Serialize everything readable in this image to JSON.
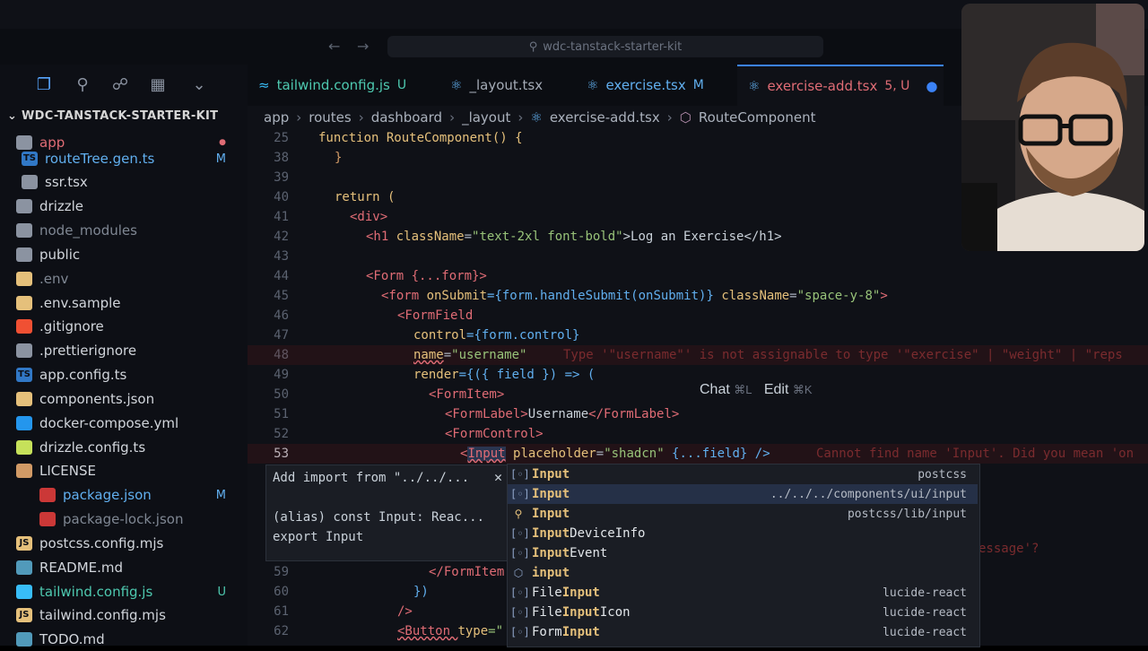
{
  "search": {
    "text": "wdc-tanstack-starter-kit"
  },
  "explorer": {
    "title": "WDC-TANSTACK-STARTER-KIT",
    "items": [
      {
        "label": "app",
        "badge": "",
        "color": "#e06c75"
      },
      {
        "label": "routeTree.gen.ts",
        "badge": "M",
        "color": "#61afef"
      },
      {
        "label": "ssr.tsx",
        "badge": "",
        "color": "#d1d5db"
      },
      {
        "label": "drizzle",
        "badge": "",
        "color": "#d1d5db"
      },
      {
        "label": "node_modules",
        "badge": "",
        "color": "#7f8793"
      },
      {
        "label": "public",
        "badge": "",
        "color": "#d1d5db"
      },
      {
        "label": ".env",
        "badge": "",
        "color": "#7f8793"
      },
      {
        "label": ".env.sample",
        "badge": "",
        "color": "#d1d5db"
      },
      {
        "label": ".gitignore",
        "badge": "",
        "color": "#d1d5db"
      },
      {
        "label": ".prettierignore",
        "badge": "",
        "color": "#d1d5db"
      },
      {
        "label": "app.config.ts",
        "badge": "",
        "color": "#d1d5db"
      },
      {
        "label": "components.json",
        "badge": "",
        "color": "#d1d5db"
      },
      {
        "label": "docker-compose.yml",
        "badge": "",
        "color": "#d1d5db"
      },
      {
        "label": "drizzle.config.ts",
        "badge": "",
        "color": "#d1d5db"
      },
      {
        "label": "LICENSE",
        "badge": "",
        "color": "#d1d5db"
      },
      {
        "label": "package.json",
        "badge": "M",
        "color": "#61afef"
      },
      {
        "label": "package-lock.json",
        "badge": "",
        "color": "#7f8793"
      },
      {
        "label": "postcss.config.mjs",
        "badge": "",
        "color": "#d1d5db"
      },
      {
        "label": "README.md",
        "badge": "",
        "color": "#d1d5db"
      },
      {
        "label": "tailwind.config.js",
        "badge": "U",
        "color": "#4ec9b0"
      },
      {
        "label": "tailwind.config.mjs",
        "badge": "",
        "color": "#d1d5db"
      },
      {
        "label": "TODO.md",
        "badge": "",
        "color": "#d1d5db"
      }
    ]
  },
  "tabs": [
    {
      "label": "tailwind.config.js",
      "status": "U"
    },
    {
      "label": "_layout.tsx",
      "status": ""
    },
    {
      "label": "exercise.tsx",
      "status": "M"
    },
    {
      "label": "exercise-add.tsx",
      "status": "5, U"
    }
  ],
  "breadcrumb": [
    "app",
    "routes",
    "dashboard",
    "_layout",
    "exercise-add.tsx",
    "RouteComponent"
  ],
  "code": {
    "line_numbers": [
      "25",
      "38",
      "39",
      "40",
      "41",
      "42",
      "43",
      "44",
      "45",
      "46",
      "47",
      "48",
      "49",
      "50",
      "51",
      "52",
      "53",
      "",
      "",
      "",
      "",
      "",
      "59",
      "60",
      "61",
      "62"
    ],
    "l25": "function RouteComponent() {",
    "l38": "}",
    "l40": "return (",
    "l41": "<div>",
    "l42_open": "<h1 ",
    "l42_attr": "className",
    "l42_str": "\"text-2xl font-bold\"",
    "l42_text": ">Log an Exercise</h1>",
    "l44": "<Form {...form}>",
    "l45_a": "<form ",
    "l45_b": "onSubmit",
    "l45_c": "={form.handleSubmit(onSubmit)} ",
    "l45_d": "className",
    "l45_e": "\"space-y-8\"",
    "l45_f": ">",
    "l46": "<FormField",
    "l47_a": "control",
    "l47_b": "={form.control}",
    "l48_a": "name",
    "l48_b": "=",
    "l48_c": "\"username\"",
    "l48_err": "Type '\"username\"' is not assignable to type '\"exercise\" | \"weight\" | \"reps",
    "l49_a": "render",
    "l49_b": "={({ field }) => (",
    "l50": "<FormItem>",
    "l51_a": "<FormLabel>",
    "l51_b": "Username",
    "l51_c": "</FormLabel>",
    "l52": "<FormControl>",
    "l53_a": "<",
    "l53_b": "Input",
    "l53_c": " placeholder",
    "l53_d": "=",
    "l53_e": "\"shadcn\"",
    "l53_f": " {...field} />",
    "l53_err": "Cannot find name 'Input'. Did you mean 'on",
    "l58_err": "essage'?",
    "l59": "</FormItem",
    "l60": "})",
    "l61": "/>",
    "l62_a": "<Button ",
    "l62_b": "type",
    "l62_c": "=\""
  },
  "chat_hint": {
    "chat": "Chat",
    "chat_key": "⌘L",
    "edit": "Edit",
    "edit_key": "⌘K"
  },
  "hover": {
    "line1": "Add import from \"../../...",
    "line2": "(alias) const Input: Reac...",
    "line3": "export Input"
  },
  "suggestions": [
    {
      "icon": "var",
      "match": "Input",
      "rest": "",
      "detail": "postcss"
    },
    {
      "icon": "var",
      "match": "Input",
      "rest": "",
      "detail": "../../../components/ui/input"
    },
    {
      "icon": "class",
      "match": "Input",
      "rest": "",
      "detail": "postcss/lib/input"
    },
    {
      "icon": "var",
      "match": "Input",
      "rest": "DeviceInfo",
      "detail": ""
    },
    {
      "icon": "var",
      "match": "Input",
      "rest": "Event",
      "detail": ""
    },
    {
      "icon": "field",
      "match": "input",
      "rest": "",
      "detail": ""
    },
    {
      "icon": "var",
      "pre": "File",
      "match": "Input",
      "rest": "",
      "detail": "lucide-react"
    },
    {
      "icon": "var",
      "pre": "File",
      "match": "Input",
      "rest": "Icon",
      "detail": "lucide-react"
    },
    {
      "icon": "var",
      "pre": "Form",
      "match": "Input",
      "rest": "",
      "detail": "lucide-react"
    }
  ]
}
